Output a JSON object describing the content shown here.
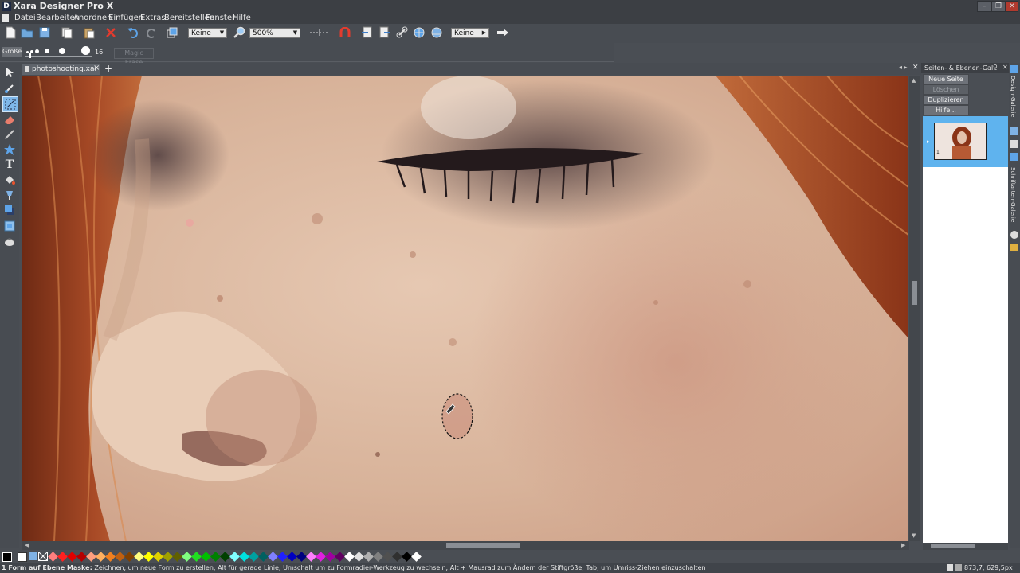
{
  "window": {
    "title": "Xara Designer Pro X",
    "app_icon": "D",
    "controls": [
      "minimize-icon",
      "restore-icon",
      "close-icon"
    ]
  },
  "menu": [
    "Datei",
    "Bearbeiten",
    "Anordnen",
    "Einfügen",
    "Extras",
    "Bereitstellen",
    "Fenster",
    "Hilfe"
  ],
  "toolbar": {
    "quality_select": "Keine",
    "zoom_select": "500%",
    "feather_select": "Keine"
  },
  "brush_bar": {
    "size_label": "Größe",
    "size_value": "16",
    "magic_erase_label": "Magic Erase"
  },
  "document_tab": {
    "label": "photoshooting.xar *",
    "close": "×",
    "add": "+"
  },
  "side_panel": {
    "title": "Seiten- & Ebenen-Gal...",
    "buttons": [
      "Neue Seite",
      "Löschen",
      "Duplizieren",
      "Hilfe..."
    ],
    "page_number": "1",
    "selected_page_color": "#5fb3ee"
  },
  "right_tabs": {
    "design_gallery": "Design-Galerie",
    "fonts_gallery": "Schriftarten-Galerie"
  },
  "palette": {
    "colors": [
      "#ff7f7f",
      "#ff2020",
      "#e00000",
      "#b40000",
      "#ff9f7f",
      "#ffb060",
      "#f08020",
      "#c06010",
      "#804000",
      "#ffff80",
      "#ffff00",
      "#e0d000",
      "#a0a000",
      "#606000",
      "#80ff80",
      "#20e020",
      "#00c000",
      "#008000",
      "#004000",
      "#80ffff",
      "#00e0e0",
      "#00a0a0",
      "#006060",
      "#8080ff",
      "#2020ff",
      "#0000c0",
      "#000080",
      "#ff80ff",
      "#e020e0",
      "#a000a0",
      "#600060",
      "#ffffff",
      "#e0e0e0",
      "#b0b0b0",
      "#808080",
      "#505050",
      "#303030",
      "#000000",
      "#ffffff"
    ]
  },
  "status": {
    "message_bold": "1 Form auf Ebene Maske:",
    "message": " Zeichnen, um neue Form zu erstellen; Alt für gerade Linie; Umschalt um zu Formradier-Werkzeug zu wechseln; Alt + Mausrad zum Ändern der Stiftgröße; Tab, um Umriss-Ziehen einzuschalten",
    "coordinates": "873,7, 629,5px"
  }
}
